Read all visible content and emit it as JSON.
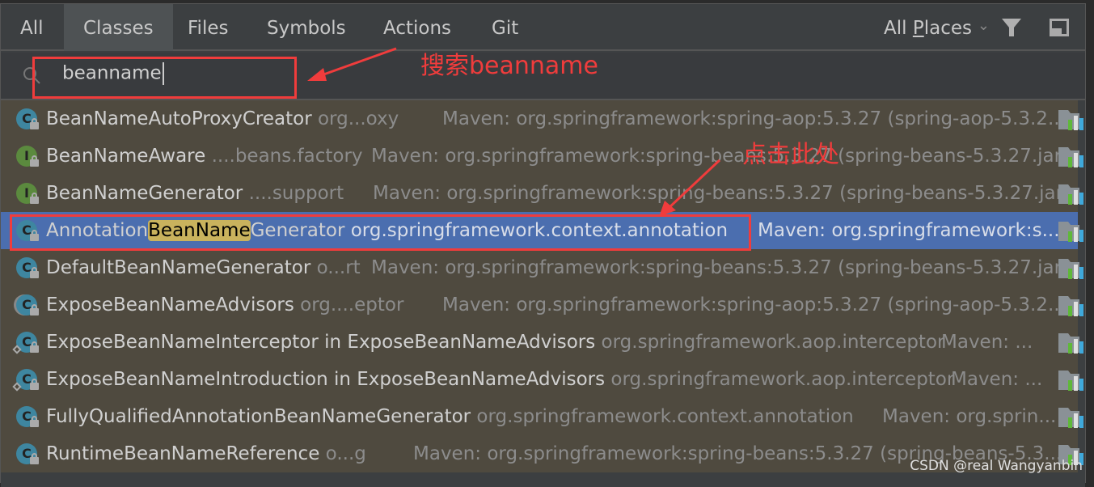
{
  "tabs": [
    "All",
    "Classes",
    "Files",
    "Symbols",
    "Actions",
    "Git"
  ],
  "selected_tab": "Classes",
  "scope": {
    "prefix": "All ",
    "mnemonic": "P",
    "rest": "laces"
  },
  "search": {
    "value": "beanname"
  },
  "results": [
    {
      "icon": "class",
      "pre": "BeanNameAutoProxyCreator",
      "hl": "",
      "post": "",
      "pkg": " org...oxy",
      "loc": "Maven: org.springframework:spring-aop:5.3.27 (spring-aop-5.3.2..."
    },
    {
      "icon": "interface",
      "pre": "BeanNameAware",
      "hl": "",
      "post": "",
      "pkg": " ....beans.factory",
      "loc": "Maven: org.springframework:spring-beans:5.3.27 (spring-beans-5.3.27.jar)"
    },
    {
      "icon": "interface",
      "pre": "BeanNameGenerator",
      "hl": "",
      "post": "",
      "pkg": " ....support",
      "loc": "Maven: org.springframework:spring-beans:5.3.27 (spring-beans-5.3.27.jar)"
    },
    {
      "icon": "class",
      "pre": "Annotation",
      "hl": "BeanName",
      "post": "Generator",
      "pkg": " org.springframework.context.annotation",
      "loc": "Maven: org.springframework:s...",
      "selected": true
    },
    {
      "icon": "class",
      "pre": "DefaultBeanNameGenerator",
      "hl": "",
      "post": "",
      "pkg": " o...rt",
      "loc": "Maven: org.springframework:spring-beans:5.3.27 (spring-beans-5.3.27.jar)"
    },
    {
      "icon": "abstract-class",
      "pre": "ExposeBeanNameAdvisors",
      "hl": "",
      "post": "",
      "pkg": " org....eptor",
      "loc": "Maven: org.springframework:spring-aop:5.3.27 (spring-aop-5.3.2..."
    },
    {
      "icon": "inner-class",
      "pre": "ExposeBeanNameInterceptor in ExposeBeanNameAdvisors",
      "hl": "",
      "post": "",
      "pkg": " org.springframework.aop.interceptor",
      "loc": "Maven: ..."
    },
    {
      "icon": "inner-class",
      "pre": "ExposeBeanNameIntroduction in ExposeBeanNameAdvisors",
      "hl": "",
      "post": "",
      "pkg": " org.springframework.aop.interceptor",
      "loc": "Maven: ..."
    },
    {
      "icon": "class",
      "pre": "FullyQualifiedAnnotationBeanNameGenerator",
      "hl": "",
      "post": "",
      "pkg": " org.springframework.context.annotation",
      "loc": "Maven: org.sprin..."
    },
    {
      "icon": "class",
      "pre": "RuntimeBeanNameReference",
      "hl": "",
      "post": "",
      "pkg": " o...g",
      "loc": "Maven: org.springframework:spring-beans:5.3.27 (spring-beans-5.3...."
    }
  ],
  "annotations": {
    "search_note": "搜索beanname",
    "click_note": "点击此处",
    "color": "#f03c3c"
  },
  "watermark": "CSDN @real Wangyanbin",
  "colors": {
    "selection": "#4b6eaf",
    "highlight": "#c9b25d",
    "list_bg": "#4f4a3f"
  }
}
